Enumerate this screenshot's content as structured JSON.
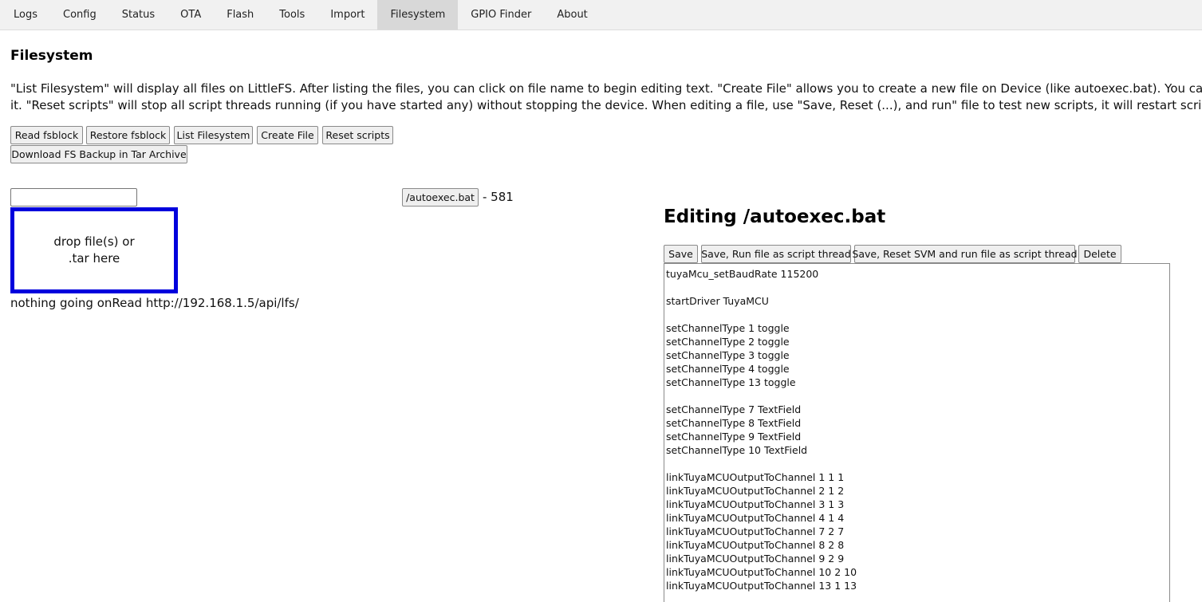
{
  "tabs": [
    {
      "label": "Logs",
      "active": false
    },
    {
      "label": "Config",
      "active": false
    },
    {
      "label": "Status",
      "active": false
    },
    {
      "label": "OTA",
      "active": false
    },
    {
      "label": "Flash",
      "active": false
    },
    {
      "label": "Tools",
      "active": false
    },
    {
      "label": "Import",
      "active": false
    },
    {
      "label": "Filesystem",
      "active": true
    },
    {
      "label": "GPIO Finder",
      "active": false
    },
    {
      "label": "About",
      "active": false
    }
  ],
  "page": {
    "title": "Filesystem",
    "description_line1": "\"List Filesystem\" will display all files on LittleFS. After listing the files, you can click on file name to begin editing text. \"Create File\" allows you to create a new file on Device (like autoexec.bat). You can also add files",
    "description_line2": "it. \"Reset scripts\" will stop all script threads running (if you have started any) without stopping the device. When editing a file, use \"Save, Reset (...), and run\" file to test new scripts, it will restart scripting every time w"
  },
  "toolbar": {
    "read_fsblock": "Read fsblock",
    "restore_fsblock": "Restore fsblock",
    "list_filesystem": "List Filesystem",
    "create_file": "Create File",
    "reset_scripts": "Reset scripts",
    "download_backup": "Download FS Backup in Tar Archive"
  },
  "upload": {
    "dropzone_line1": "drop file(s) or",
    "dropzone_line2": ".tar here",
    "status": "nothing going onRead http://192.168.1.5/api/lfs/"
  },
  "files": [
    {
      "name": "/autoexec.bat",
      "size_text": "- 581"
    }
  ],
  "editor": {
    "title": "Editing /autoexec.bat",
    "save": "Save",
    "save_run": "Save, Run file as script thread",
    "save_reset_run": "Save, Reset SVM and run file as script thread",
    "delete": "Delete",
    "content_lines": [
      "tuyaMcu_setBaudRate 115200",
      "",
      "startDriver TuyaMCU",
      "",
      "setChannelType 1 toggle",
      "setChannelType 2 toggle",
      "setChannelType 3 toggle",
      "setChannelType 4 toggle",
      "setChannelType 13 toggle",
      "",
      "setChannelType 7 TextField",
      "setChannelType 8 TextField",
      "setChannelType 9 TextField",
      "setChannelType 10 TextField",
      "",
      "linkTuyaMCUOutputToChannel 1 1 1",
      "linkTuyaMCUOutputToChannel 2 1 2",
      "linkTuyaMCUOutputToChannel 3 1 3",
      "linkTuyaMCUOutputToChannel 4 1 4",
      "linkTuyaMCUOutputToChannel 7 2 7",
      "linkTuyaMCUOutputToChannel 8 2 8",
      "linkTuyaMCUOutputToChannel 9 2 9",
      "linkTuyaMCUOutputToChannel 10 2 10",
      "linkTuyaMCUOutputToChannel 13 1 13"
    ]
  }
}
